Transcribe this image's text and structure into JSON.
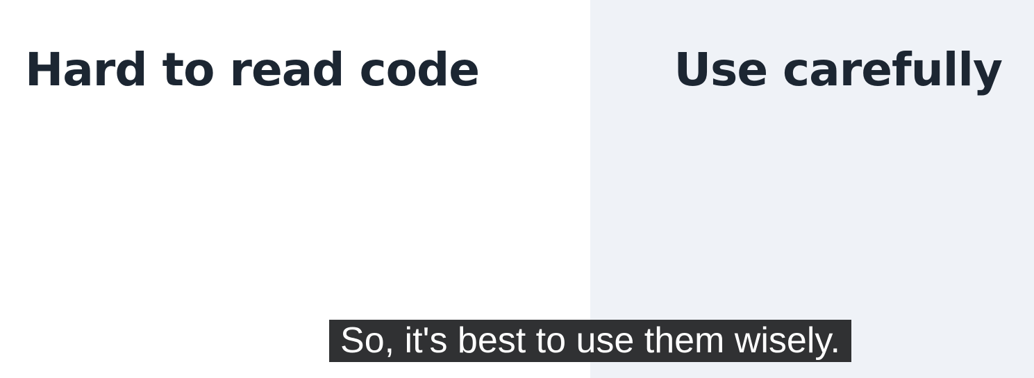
{
  "left_panel": {
    "title": "Hard to read code"
  },
  "right_panel": {
    "title": "Use carefully"
  },
  "caption": {
    "text": "So, it's best to use them wisely."
  },
  "colors": {
    "left_bg": "#ffffff",
    "right_bg": "#eff2f7",
    "heading": "#1c2632",
    "caption_bg": "#303133"
  }
}
